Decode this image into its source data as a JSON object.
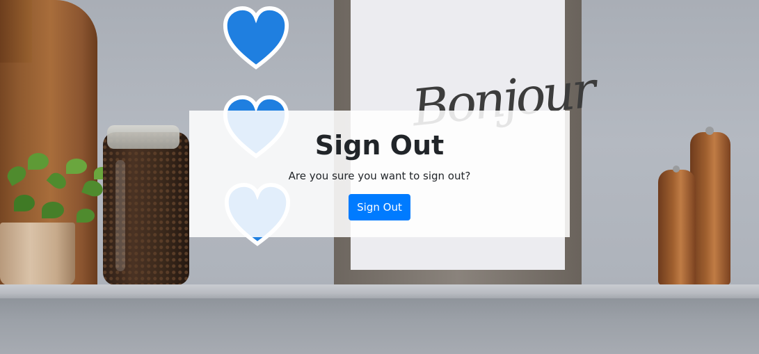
{
  "modal": {
    "title": "Sign Out",
    "message": "Are you sure you want to sign out?",
    "signout_label": "Sign Out"
  },
  "background": {
    "frame_text": "Bonjour"
  },
  "colors": {
    "button_primary": "#007bff",
    "text_dark": "#212529",
    "heart_blue": "#1f7fe0"
  }
}
